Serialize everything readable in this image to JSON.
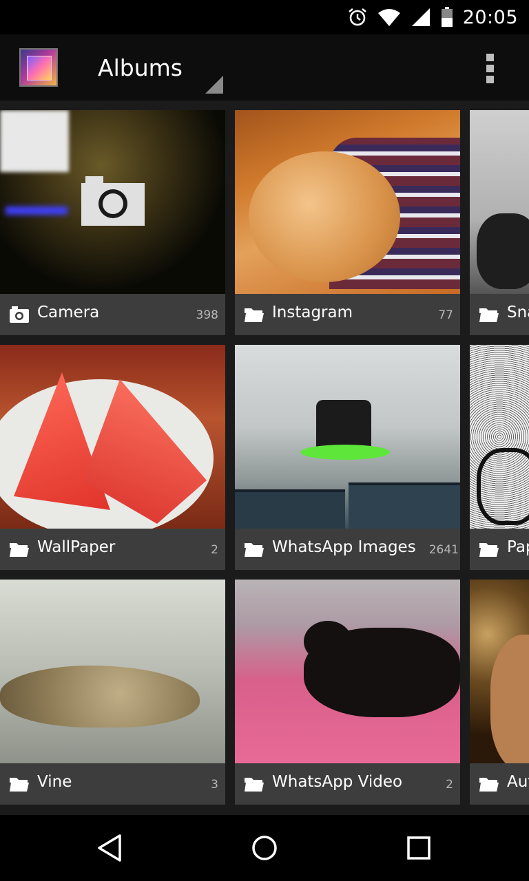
{
  "status_bar": {
    "time": "20:05",
    "icons": [
      "alarm-icon",
      "wifi-icon",
      "signal-icon",
      "battery-icon"
    ]
  },
  "action_bar": {
    "title": "Albums",
    "app_icon": "gallery-app-icon",
    "menu_icon": "overflow-menu-icon"
  },
  "albums": [
    {
      "name": "Camera",
      "count": "398",
      "icon": "camera-icon"
    },
    {
      "name": "Instagram",
      "count": "77",
      "icon": "folder-icon"
    },
    {
      "name": "Sna",
      "count": "",
      "icon": "folder-icon"
    },
    {
      "name": "WallPaper",
      "count": "2",
      "icon": "folder-icon"
    },
    {
      "name": "WhatsApp Images",
      "count": "2641",
      "icon": "folder-icon"
    },
    {
      "name": "Pap",
      "count": "",
      "icon": "folder-icon"
    },
    {
      "name": "Vine",
      "count": "3",
      "icon": "folder-icon"
    },
    {
      "name": "WhatsApp Video",
      "count": "2",
      "icon": "folder-icon"
    },
    {
      "name": "Aut",
      "count": "",
      "icon": "folder-icon"
    }
  ],
  "nav_bar": {
    "icons": [
      "back-icon",
      "home-icon",
      "recents-icon"
    ]
  },
  "colors": {
    "status_bar": "#000000",
    "action_bar": "#0d0d0d",
    "background": "#1b1b1b",
    "label_bar": "#3d3d3d"
  }
}
